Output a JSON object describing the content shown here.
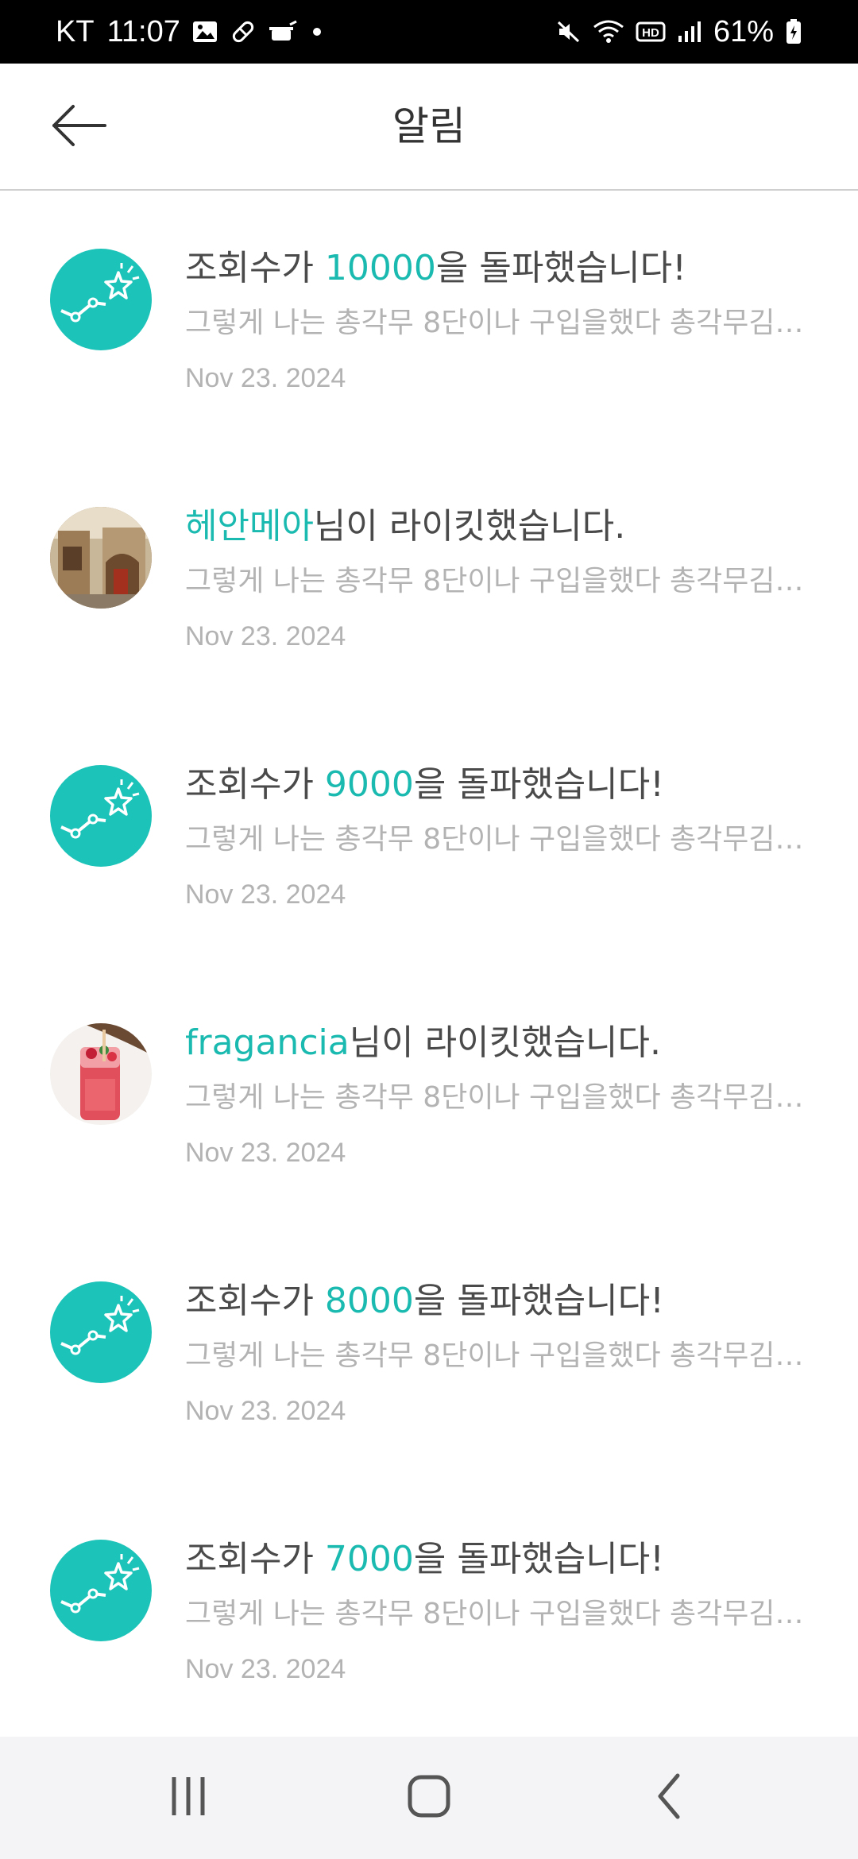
{
  "status_bar": {
    "carrier": "KT",
    "time": "11:07",
    "battery": "61%"
  },
  "header": {
    "title": "알림"
  },
  "notifications": [
    {
      "type": "views",
      "title_prefix": "조회수가 ",
      "highlight": "10000",
      "title_suffix": "을 돌파했습니다!",
      "preview": "그렇게 나는 총각무 8단이나 구입을했다 총각무김치 담그기",
      "date": "Nov 23. 2024"
    },
    {
      "type": "like",
      "title_prefix": "",
      "highlight": "헤안메아",
      "title_suffix": "님이 라이킷했습니다.",
      "preview": "그렇게 나는 총각무 8단이나 구입을했다 총각무김치 담그기",
      "date": "Nov 23. 2024"
    },
    {
      "type": "views",
      "title_prefix": "조회수가 ",
      "highlight": "9000",
      "title_suffix": "을 돌파했습니다!",
      "preview": "그렇게 나는 총각무 8단이나 구입을했다 총각무김치 담그기",
      "date": "Nov 23. 2024"
    },
    {
      "type": "like",
      "title_prefix": "",
      "highlight": "fragancia",
      "title_suffix": "님이 라이킷했습니다.",
      "preview": "그렇게 나는 총각무 8단이나 구입을했다 총각무김치 담그기",
      "date": "Nov 23. 2024"
    },
    {
      "type": "views",
      "title_prefix": "조회수가 ",
      "highlight": "8000",
      "title_suffix": "을 돌파했습니다!",
      "preview": "그렇게 나는 총각무 8단이나 구입을했다 총각무김치 담그기",
      "date": "Nov 23. 2024"
    },
    {
      "type": "views",
      "title_prefix": "조회수가 ",
      "highlight": "7000",
      "title_suffix": "을 돌파했습니다!",
      "preview": "그렇게 나는 총각무 8단이나 구입을했다 총각무김치 담그기",
      "date": "Nov 23. 2024"
    }
  ],
  "colors": {
    "accent": "#1bbab0",
    "avatar_teal": "#1cc3b8"
  },
  "icons": {
    "back": "arrow-left-icon",
    "views": "trend-star-icon",
    "nav_recent": "recent-apps-icon",
    "nav_home": "home-icon",
    "nav_back": "chevron-left-icon"
  }
}
